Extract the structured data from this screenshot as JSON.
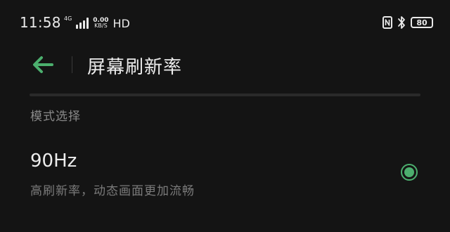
{
  "status_bar": {
    "time": "11:58",
    "network_generation": "4G",
    "speed_value": "0.00",
    "speed_unit": "KB/S",
    "hd_label": "HD",
    "battery_level": "80"
  },
  "header": {
    "title": "屏幕刷新率"
  },
  "section": {
    "label": "模式选择"
  },
  "option": {
    "title": "90Hz",
    "subtitle": "高刷新率，动态画面更加流畅",
    "selected": true
  },
  "colors": {
    "accent": "#4caf6e",
    "background": "#141414"
  },
  "icons": {
    "back": "arrow-left-icon",
    "nfc": "nfc-icon",
    "bluetooth": "bluetooth-icon",
    "battery": "battery-icon",
    "signal": "signal-bars-icon"
  }
}
